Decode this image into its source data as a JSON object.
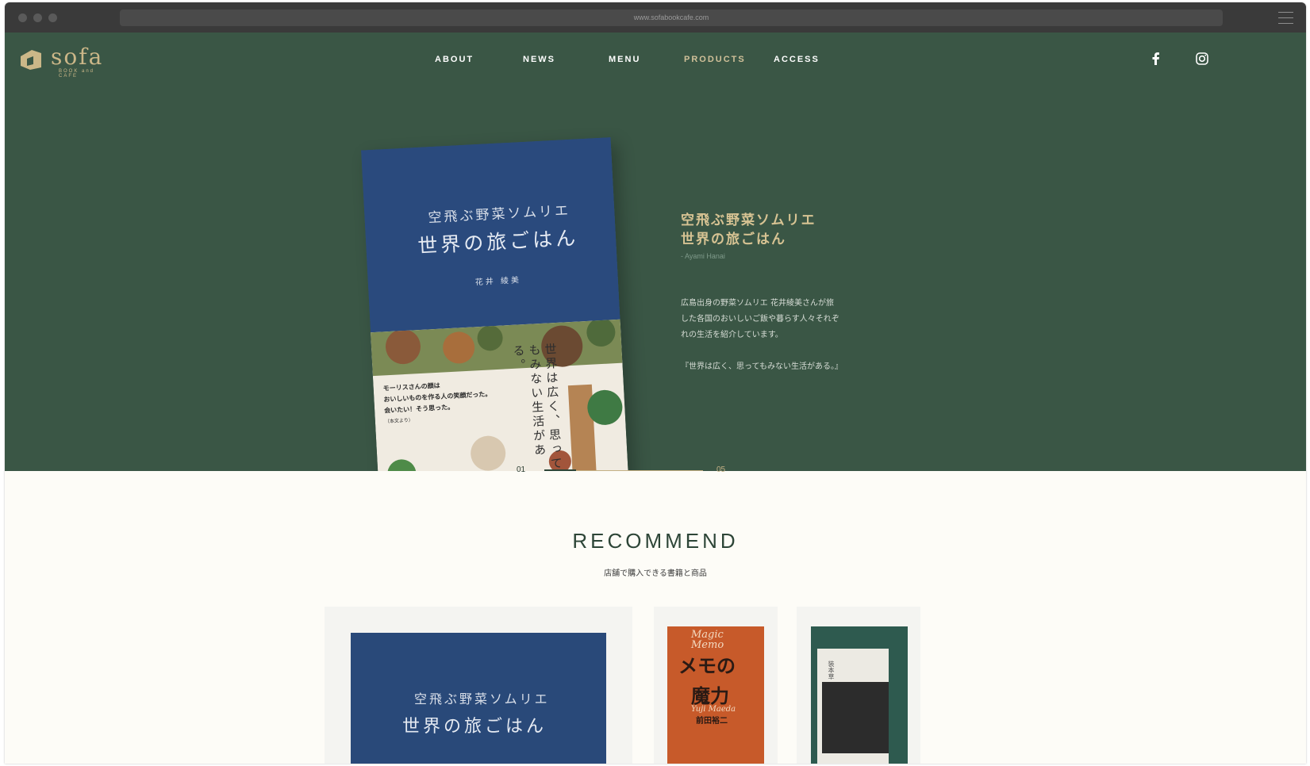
{
  "browser": {
    "url": "www.sofabookcafe.com"
  },
  "brand": {
    "name": "sofa",
    "tagline": "BOOK and CAFE",
    "color": "#cbb788"
  },
  "nav": {
    "items": [
      {
        "label": "ABOUT"
      },
      {
        "label": "NEWS"
      },
      {
        "label": "MENU"
      },
      {
        "label": "PRODUCTS",
        "active": true
      },
      {
        "label": "ACCESS"
      }
    ]
  },
  "social": {
    "icons": [
      "facebook-icon",
      "instagram-icon"
    ]
  },
  "hero": {
    "background": "#3a5645",
    "book_cover": {
      "title_line1": "空飛ぶ野菜ソムリエ",
      "title_line2": "世界の旅ごはん",
      "author": "花井 綾美",
      "vertical_text": "世界は広く、思ってもみない生活がある。",
      "quote_line1": "モーリスさんの顔は",
      "quote_line2": "おいしいものを作る人の笑顔だった。",
      "quote_line3": "会いたい！そう思った。",
      "quote_source": "（本文より）"
    },
    "title_line1": "空飛ぶ野菜ソムリエ",
    "title_line2": "世界の旅ごはん",
    "author": "-  Ayami Hanai",
    "desc_line1": "広島出身の野菜ソムリエ 花井綾美さんが旅",
    "desc_line2": "した各国のおいしいご飯や暮らす人々それぞ",
    "desc_line3": "れの生活を紹介しています。",
    "quote": "『世界は広く、思ってもみない生活がある。』"
  },
  "pager": {
    "current": "01",
    "total": "05",
    "progress": 0.2
  },
  "recommend": {
    "title": "RECOMMEND",
    "subtitle": "店舗で購入できる書籍と商品",
    "cards": [
      {
        "title_line1": "空飛ぶ野菜ソムリエ",
        "title_line2": "世界の旅ごはん"
      },
      {
        "title_en1": "Magic",
        "title_en2": "Memo",
        "title_jp1": "メモの",
        "title_jp2": "魔力",
        "author_en": "Yuji Maeda",
        "author": "前田裕二"
      },
      {
        "vertical_title": "装本草"
      }
    ]
  }
}
